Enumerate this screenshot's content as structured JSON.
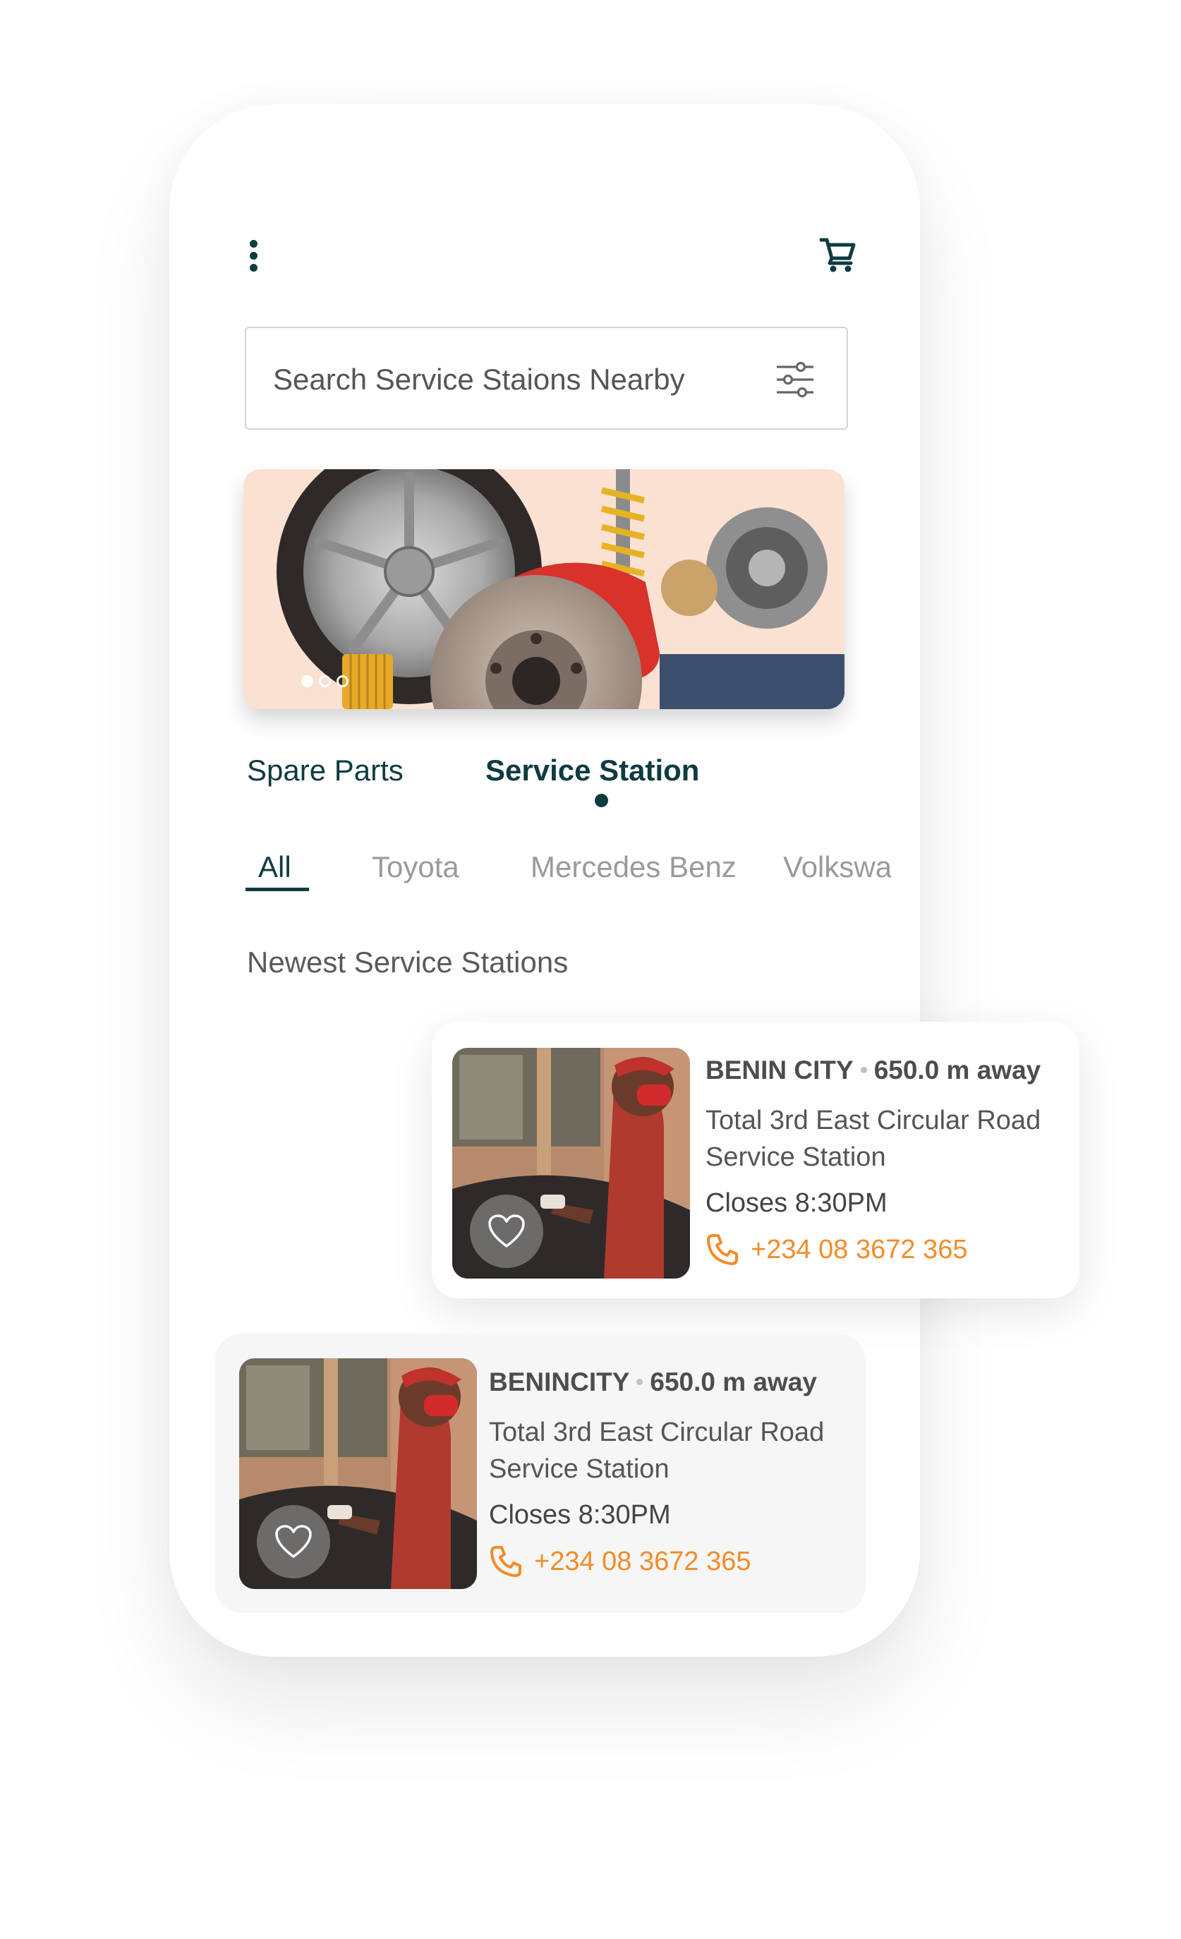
{
  "header": {
    "menu_icon": "more-vertical-icon",
    "cart_icon": "shopping-cart-icon"
  },
  "search": {
    "placeholder": "Search Service Staions Nearby",
    "filter_icon": "sliders-icon"
  },
  "banner": {
    "slide_count": 3,
    "active_slide": 1
  },
  "main_tabs": [
    {
      "label": "Spare Parts",
      "active": false
    },
    {
      "label": "Service Station",
      "active": true
    }
  ],
  "brand_tabs": [
    {
      "label": "All",
      "active": true
    },
    {
      "label": "Toyota",
      "active": false
    },
    {
      "label": "Mercedes Benz",
      "active": false
    },
    {
      "label": "Volkswagen",
      "active": false
    }
  ],
  "section_title": "Newest Service Stations",
  "stations": [
    {
      "city": "BENIN CITY",
      "distance": "650.0 m away",
      "name": "Total 3rd East Circular Road Service Station",
      "hours": "Closes 8:30PM",
      "phone": "+234 08 3672 365"
    },
    {
      "city": "BENINCITY",
      "distance": "650.0 m away",
      "name": "Total 3rd East Circular Road Service Station",
      "hours": "Closes 8:30PM",
      "phone": "+234 08 3672 365"
    }
  ],
  "colors": {
    "primary": "#0e3b40",
    "accent": "#f28c28",
    "muted": "#9a9a9a",
    "banner_bg": "#fbe1d2"
  }
}
